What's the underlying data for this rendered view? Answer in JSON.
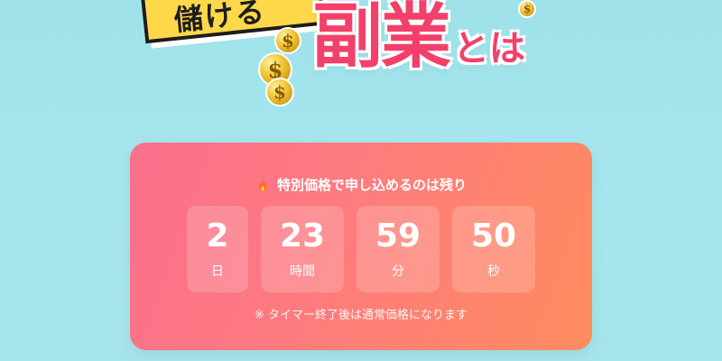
{
  "banner": {
    "badge_text": "儲ける",
    "title_main": "副業",
    "title_suffix": "とは",
    "coin_symbol": "$"
  },
  "countdown": {
    "heading": "特別価格で申し込めるのは残り",
    "icon": "fire-icon",
    "units": [
      {
        "value": "2",
        "label": "日"
      },
      {
        "value": "23",
        "label": "時間"
      },
      {
        "value": "59",
        "label": "分"
      },
      {
        "value": "50",
        "label": "秒"
      }
    ],
    "note": "※ タイマー終了後は通常価格になります"
  },
  "colors": {
    "background": "#a3e4ec",
    "card_start": "#fb6f8c",
    "card_end": "#ff8c5e",
    "title_pink": "#f2406b",
    "badge_yellow": "#ffd84a"
  }
}
